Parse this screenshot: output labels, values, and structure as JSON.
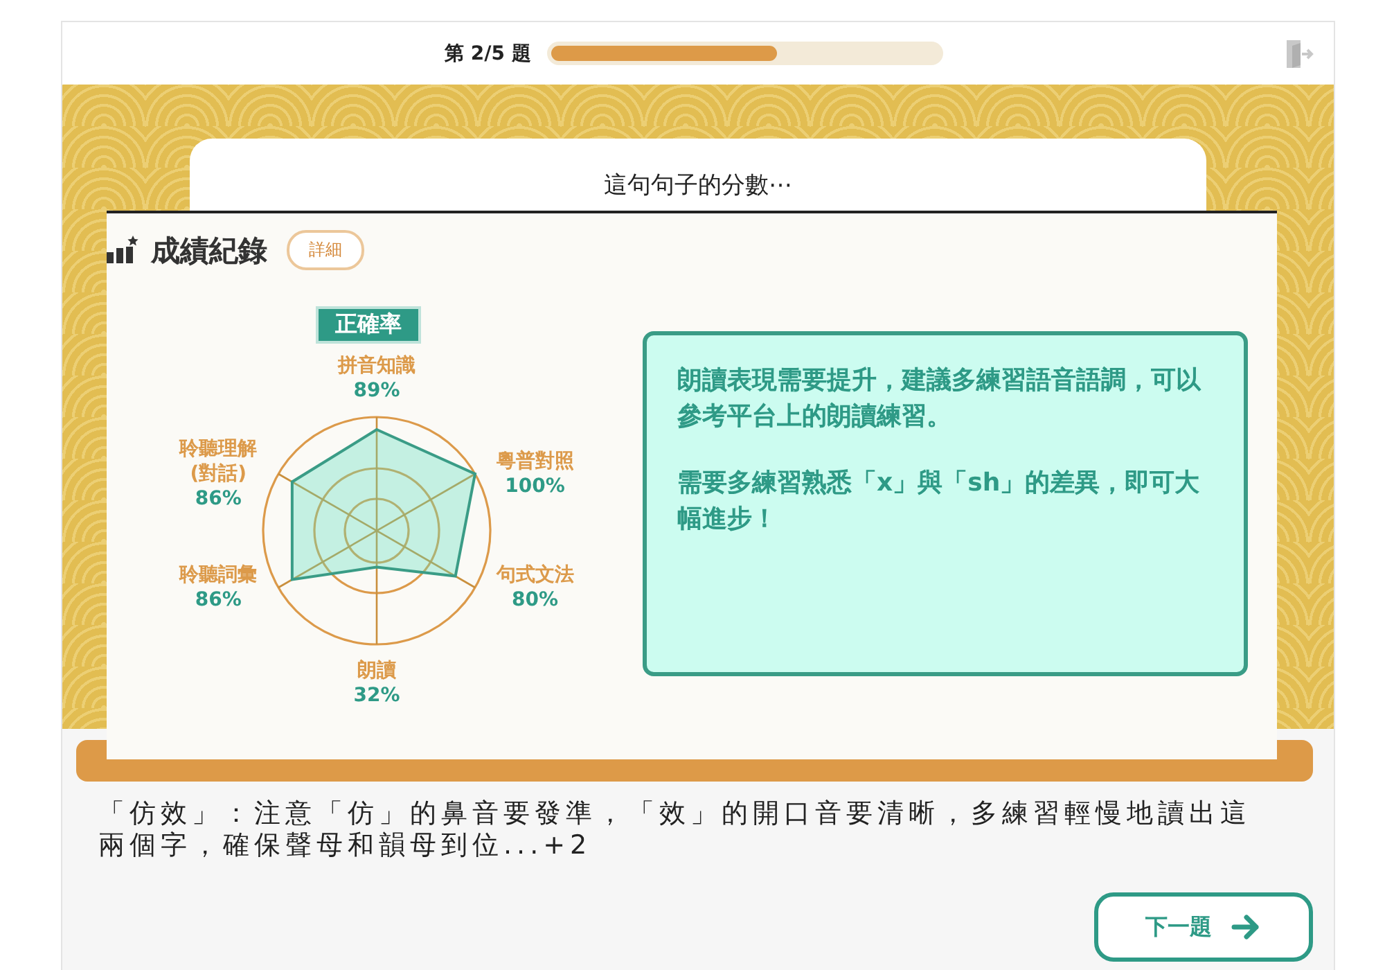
{
  "header": {
    "progress_label": "第 2/5 題",
    "progress": {
      "level": 0.58
    }
  },
  "sentence_card": {
    "title": "這句句子的分數⋯"
  },
  "report": {
    "title": "成績紀錄",
    "details_button": "詳細",
    "radar": {
      "title": "正確率",
      "axes": [
        {
          "label": "拼音知識",
          "value": "89%"
        },
        {
          "label": "聆聽理解\n(對話)",
          "value": "86%"
        },
        {
          "label": "粵普對照",
          "value": "100%"
        },
        {
          "label": "聆聽詞彙",
          "value": "86%"
        },
        {
          "label": "句式文法",
          "value": "80%"
        },
        {
          "label": "朗讀",
          "value": "32%"
        }
      ]
    },
    "comments": [
      "朗讀表現需要提升，建議多練習語音語調，可以參考平台上的朗讀練習。",
      "需要多練習熟悉「x」與「sh」的差異，即可大幅進步！"
    ]
  },
  "feedback_text": "「仿效」：注意「仿」的鼻音要發準，「效」的開口音要清晰，多練習輕慢地讀出這兩個字，確保聲母和韻母到位...+2",
  "next_button": "下一題"
}
